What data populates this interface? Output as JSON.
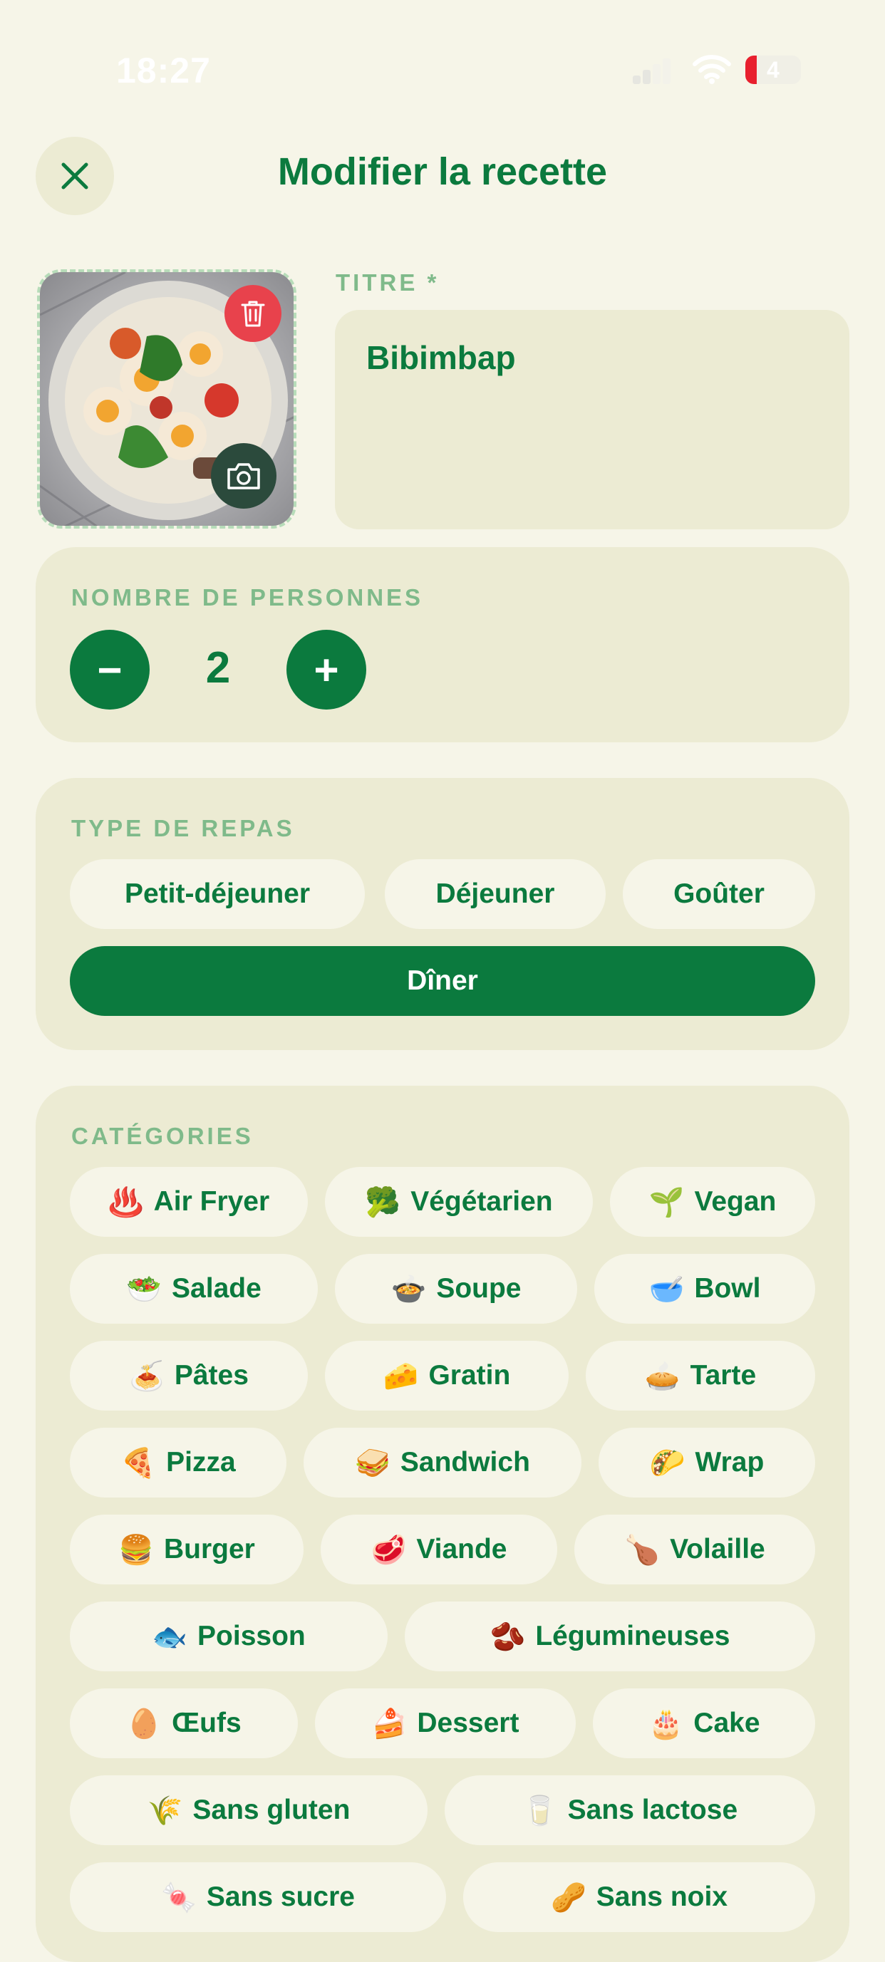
{
  "status": {
    "time": "18:27",
    "battery": "4"
  },
  "header": {
    "title": "Modifier la recette"
  },
  "form": {
    "title_label": "TITRE *",
    "title_value": "Bibimbap",
    "persons_label": "NOMBRE DE PERSONNES",
    "persons_count": "2",
    "minus": "−",
    "plus": "+"
  },
  "meal_type": {
    "label": "TYPE DE REPAS",
    "options": [
      "Petit-déjeuner",
      "Déjeuner",
      "Goûter",
      "Dîner"
    ],
    "selected": "Dîner"
  },
  "categories": {
    "label": "CATÉGORIES",
    "items": [
      {
        "emoji": "♨️",
        "label": "Air Fryer"
      },
      {
        "emoji": "🥦",
        "label": "Végétarien"
      },
      {
        "emoji": "🌱",
        "label": "Vegan"
      },
      {
        "emoji": "🥗",
        "label": "Salade"
      },
      {
        "emoji": "🍲",
        "label": "Soupe"
      },
      {
        "emoji": "🥣",
        "label": "Bowl"
      },
      {
        "emoji": "🍝",
        "label": "Pâtes"
      },
      {
        "emoji": "🧀",
        "label": "Gratin"
      },
      {
        "emoji": "🥧",
        "label": "Tarte"
      },
      {
        "emoji": "🍕",
        "label": "Pizza"
      },
      {
        "emoji": "🥪",
        "label": "Sandwich"
      },
      {
        "emoji": "🌮",
        "label": "Wrap"
      },
      {
        "emoji": "🍔",
        "label": "Burger"
      },
      {
        "emoji": "🥩",
        "label": "Viande"
      },
      {
        "emoji": "🍗",
        "label": "Volaille"
      },
      {
        "emoji": "🐟",
        "label": "Poisson"
      },
      {
        "emoji": "🫘",
        "label": "Légumineuses"
      },
      {
        "emoji": "🥚",
        "label": "Œufs"
      },
      {
        "emoji": "🍰",
        "label": "Dessert"
      },
      {
        "emoji": "🎂",
        "label": "Cake"
      },
      {
        "emoji": "🌾",
        "label": "Sans gluten"
      },
      {
        "emoji": "🥛",
        "label": "Sans lactose"
      },
      {
        "emoji": "🍬",
        "label": "Sans sucre"
      },
      {
        "emoji": "🥜",
        "label": "Sans noix"
      }
    ]
  },
  "colors": {
    "accent": "#0b7a3e",
    "background": "#f6f5e8",
    "card": "#ecebd3",
    "danger": "#e8424c"
  }
}
